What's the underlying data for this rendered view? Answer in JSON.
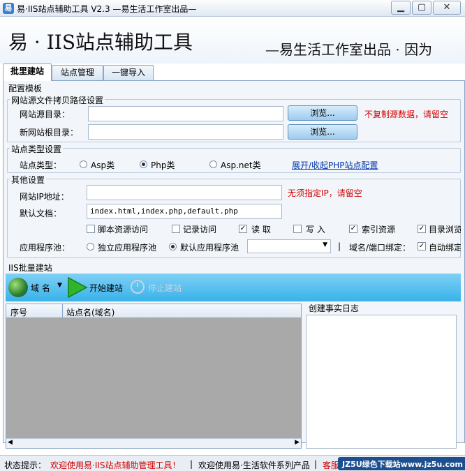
{
  "window": {
    "title": "易·IIS站点辅助工具 V2.3 —易生活工作室出品—",
    "app_icon": "易",
    "min": "▁",
    "max": "▢",
    "close": "✕"
  },
  "banner": {
    "title": "易 · IIS站点辅助工具",
    "slogan": "—易生活工作室出品 · 因为"
  },
  "tabs": [
    {
      "label": "批里建站"
    },
    {
      "label": "站点管理"
    },
    {
      "label": "一键导入"
    }
  ],
  "config": {
    "section_title": "配置模板",
    "source": {
      "group_title": "网站源文件拷贝路径设置",
      "source_dir_label": "网站源目录：",
      "source_dir_value": "",
      "browse": "浏览...",
      "source_hint": "不复制源数据，请留空",
      "root_dir_label": "新网站根目录：",
      "root_dir_value": ""
    },
    "site_type": {
      "group_title": "站点类型设置",
      "label": "站点类型：",
      "options": [
        "Asp类",
        "Php类",
        "Asp.net类"
      ],
      "selected": "Php类",
      "toggle_link": "展开/收起PHP站点配置"
    },
    "other": {
      "group_title": "其他设置",
      "ip_label": "网站IP地址：",
      "ip_value": "",
      "ip_hint": "无须指定IP，请留空",
      "doc_label": "默认文档：",
      "doc_value": "index.html,index.php,default.php",
      "permissions": [
        {
          "label": "脚本资源访问",
          "checked": false
        },
        {
          "label": "记录访问",
          "checked": false
        },
        {
          "label": "读 取",
          "checked": true
        },
        {
          "label": "写 入",
          "checked": false
        },
        {
          "label": "索引资源",
          "checked": true
        },
        {
          "label": "目录浏览",
          "checked": true
        }
      ],
      "pool_label": "应用程序池：",
      "pool_options": [
        "独立应用程序池",
        "默认应用程序池"
      ],
      "pool_selected": "默认应用程序池",
      "pool_select_value": "",
      "separator": "|",
      "binding_label": "域名/端口绑定：",
      "auto_bind_label": "自动绑定",
      "auto_bind_checked": true
    }
  },
  "batch": {
    "section_title": "IIS批量建站",
    "toolbar": {
      "domain": "域 名",
      "start": "开始建站",
      "stop": "停止建站"
    },
    "grid": {
      "columns": [
        "序号",
        "站点名(域名)"
      ],
      "rows": []
    },
    "log_title": "创建事实日志"
  },
  "statusbar": {
    "label": "状态提示：",
    "message": "欢迎使用易·IIS站点辅助管理工具！",
    "sep": "|",
    "info": "欢迎使用易·生活软件系列产品",
    "extra": "客服",
    "watermark": "JZ5U绿色下载站www.jz5u.com"
  },
  "colors": {
    "accent": "#39b2ea",
    "hint_red": "#d40000",
    "link_blue": "#0033aa"
  }
}
